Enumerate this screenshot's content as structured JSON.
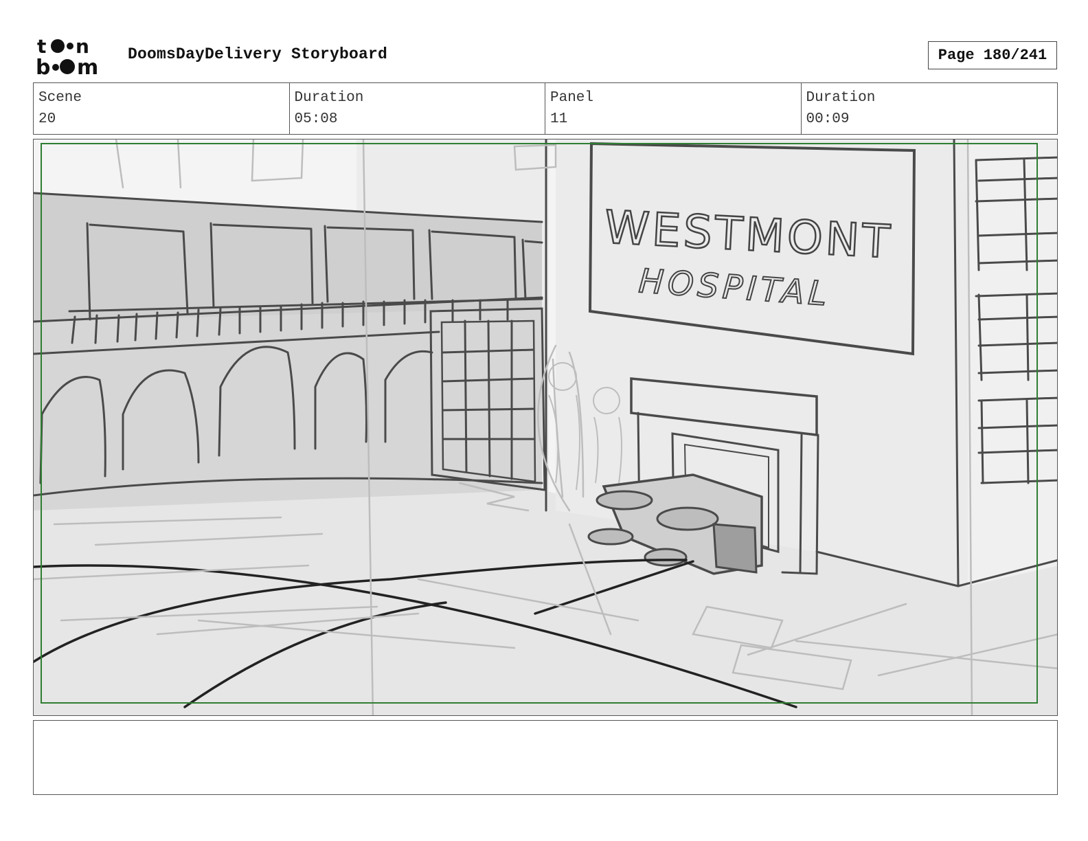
{
  "header": {
    "doc_title": "DoomsDayDelivery Storyboard",
    "page_label": "Page 180/241"
  },
  "info": {
    "scene_label": "Scene",
    "scene_value": "20",
    "scene_duration_label": "Duration",
    "scene_duration_value": "05:08",
    "panel_label": "Panel",
    "panel_value": "11",
    "panel_duration_label": "Duration",
    "panel_duration_value": "00:09"
  },
  "sketch": {
    "sign_line1": "WESTMONT",
    "sign_line2": "HOSPITAL"
  },
  "notes": {
    "text": ""
  },
  "colors": {
    "safe_frame": "#2e7d32",
    "sketch_dark": "#444444",
    "sketch_light": "#bdbdbd"
  }
}
